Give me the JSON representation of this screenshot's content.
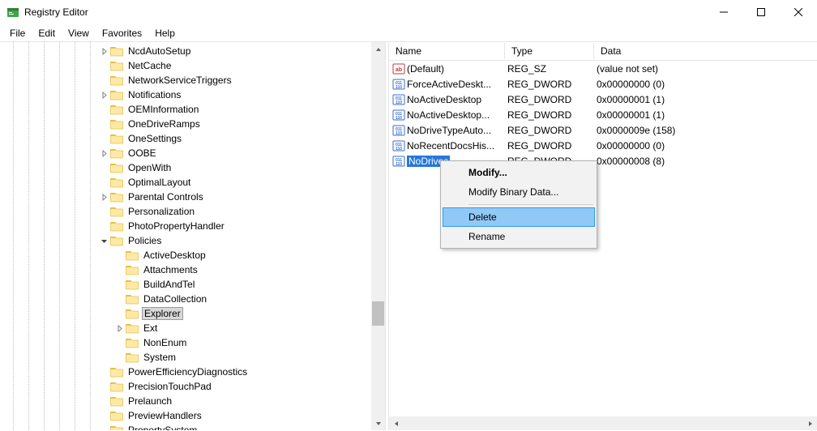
{
  "window": {
    "title": "Registry Editor"
  },
  "menu": {
    "file": "File",
    "edit": "Edit",
    "view": "View",
    "favorites": "Favorites",
    "help": "Help"
  },
  "tree": [
    {
      "indent": 7,
      "exp": "closed",
      "label": "NcdAutoSetup"
    },
    {
      "indent": 7,
      "exp": "none",
      "label": "NetCache"
    },
    {
      "indent": 7,
      "exp": "none",
      "label": "NetworkServiceTriggers"
    },
    {
      "indent": 7,
      "exp": "closed",
      "label": "Notifications"
    },
    {
      "indent": 7,
      "exp": "none",
      "label": "OEMInformation"
    },
    {
      "indent": 7,
      "exp": "none",
      "label": "OneDriveRamps"
    },
    {
      "indent": 7,
      "exp": "none",
      "label": "OneSettings"
    },
    {
      "indent": 7,
      "exp": "closed",
      "label": "OOBE"
    },
    {
      "indent": 7,
      "exp": "none",
      "label": "OpenWith"
    },
    {
      "indent": 7,
      "exp": "none",
      "label": "OptimalLayout"
    },
    {
      "indent": 7,
      "exp": "closed",
      "label": "Parental Controls"
    },
    {
      "indent": 7,
      "exp": "none",
      "label": "Personalization"
    },
    {
      "indent": 7,
      "exp": "none",
      "label": "PhotoPropertyHandler"
    },
    {
      "indent": 7,
      "exp": "open",
      "label": "Policies"
    },
    {
      "indent": 8,
      "exp": "none",
      "label": "ActiveDesktop"
    },
    {
      "indent": 8,
      "exp": "none",
      "label": "Attachments"
    },
    {
      "indent": 8,
      "exp": "none",
      "label": "BuildAndTel"
    },
    {
      "indent": 8,
      "exp": "none",
      "label": "DataCollection"
    },
    {
      "indent": 8,
      "exp": "none",
      "label": "Explorer",
      "selected": true
    },
    {
      "indent": 8,
      "exp": "closed",
      "label": "Ext"
    },
    {
      "indent": 8,
      "exp": "none",
      "label": "NonEnum"
    },
    {
      "indent": 8,
      "exp": "none",
      "label": "System"
    },
    {
      "indent": 7,
      "exp": "none",
      "label": "PowerEfficiencyDiagnostics"
    },
    {
      "indent": 7,
      "exp": "none",
      "label": "PrecisionTouchPad"
    },
    {
      "indent": 7,
      "exp": "none",
      "label": "Prelaunch"
    },
    {
      "indent": 7,
      "exp": "none",
      "label": "PreviewHandlers"
    },
    {
      "indent": 7,
      "exp": "none",
      "label": "PropertySystem"
    }
  ],
  "list": {
    "headers": {
      "name": "Name",
      "type": "Type",
      "data": "Data"
    },
    "rows": [
      {
        "icon": "sz",
        "name": "(Default)",
        "type": "REG_SZ",
        "data": "(value not set)"
      },
      {
        "icon": "dw",
        "name": "ForceActiveDeskt...",
        "type": "REG_DWORD",
        "data": "0x00000000 (0)"
      },
      {
        "icon": "dw",
        "name": "NoActiveDesktop",
        "type": "REG_DWORD",
        "data": "0x00000001 (1)"
      },
      {
        "icon": "dw",
        "name": "NoActiveDesktop...",
        "type": "REG_DWORD",
        "data": "0x00000001 (1)"
      },
      {
        "icon": "dw",
        "name": "NoDriveTypeAuto...",
        "type": "REG_DWORD",
        "data": "0x0000009e (158)"
      },
      {
        "icon": "dw",
        "name": "NoRecentDocsHis...",
        "type": "REG_DWORD",
        "data": "0x00000000 (0)"
      },
      {
        "icon": "dw",
        "name": "NoDrives",
        "type": "REG_DWORD",
        "data": "0x00000008 (8)",
        "selected": true
      }
    ]
  },
  "contextMenu": {
    "modify": "Modify...",
    "modifyBinary": "Modify Binary Data...",
    "delete": "Delete",
    "rename": "Rename"
  }
}
